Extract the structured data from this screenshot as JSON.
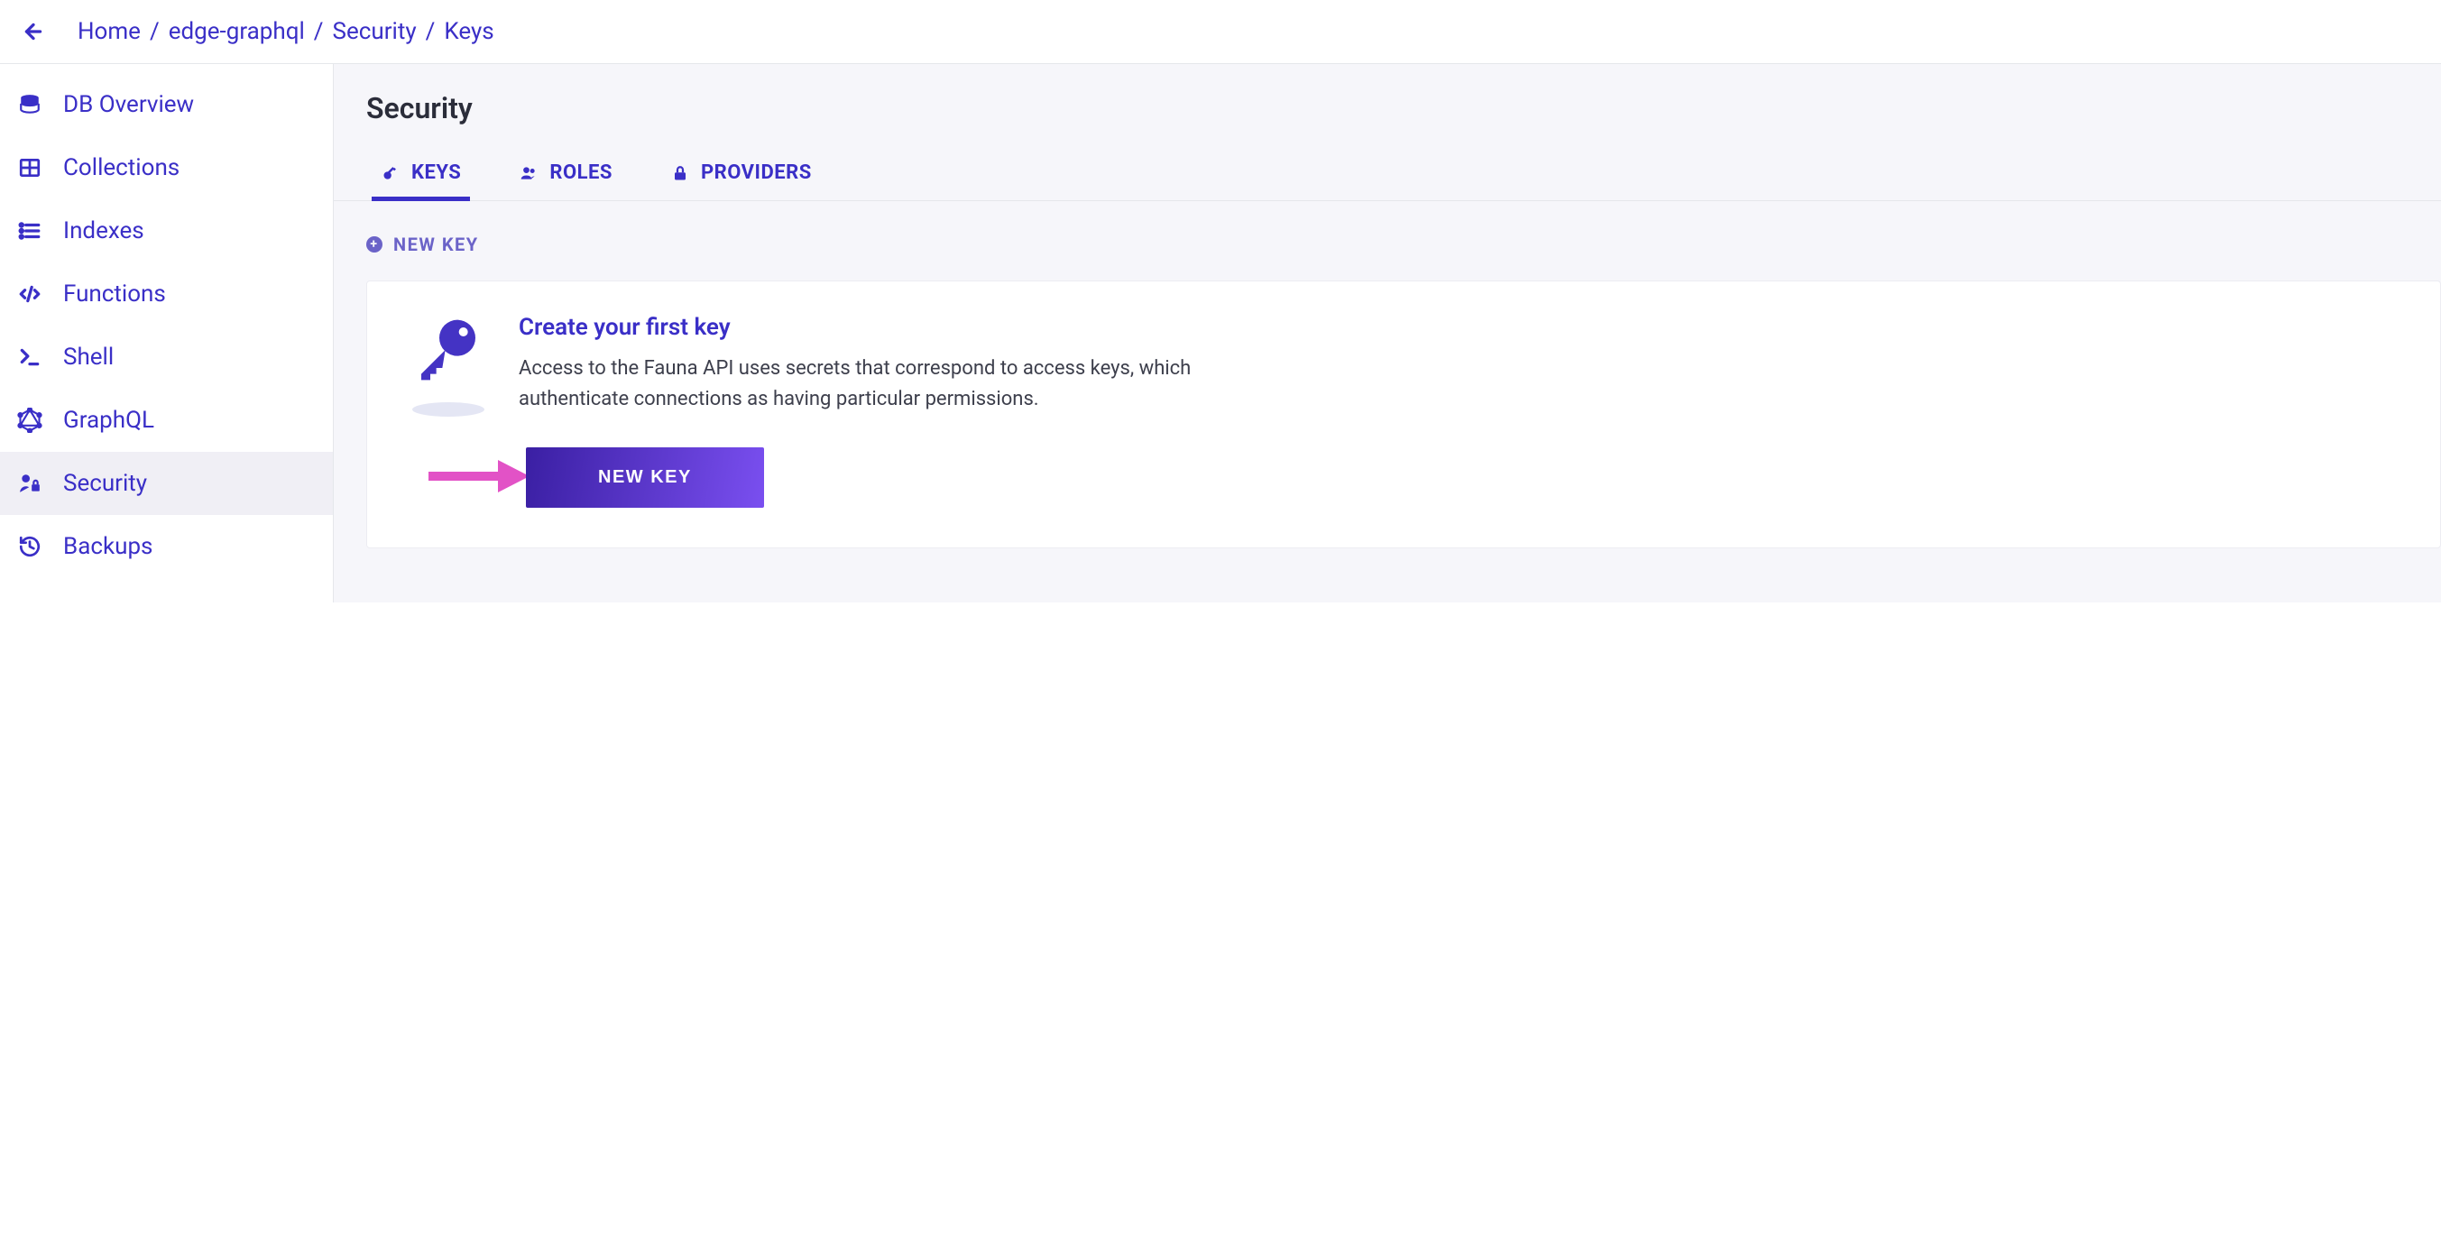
{
  "breadcrumbs": [
    "Home",
    "edge-graphql",
    "Security",
    "Keys"
  ],
  "sidebar": {
    "items": [
      {
        "label": "DB Overview",
        "icon": "database-icon"
      },
      {
        "label": "Collections",
        "icon": "table-icon"
      },
      {
        "label": "Indexes",
        "icon": "list-icon"
      },
      {
        "label": "Functions",
        "icon": "code-icon"
      },
      {
        "label": "Shell",
        "icon": "terminal-icon"
      },
      {
        "label": "GraphQL",
        "icon": "graphql-icon"
      },
      {
        "label": "Security",
        "icon": "user-lock-icon"
      },
      {
        "label": "Backups",
        "icon": "history-icon"
      }
    ],
    "active_index": 6
  },
  "page": {
    "title": "Security"
  },
  "tabs": {
    "items": [
      {
        "label": "KEYS",
        "icon": "key-icon"
      },
      {
        "label": "ROLES",
        "icon": "users-icon"
      },
      {
        "label": "PROVIDERS",
        "icon": "lock-icon"
      }
    ],
    "active_index": 0,
    "new_key_link": "NEW KEY"
  },
  "empty_state": {
    "heading": "Create your first key",
    "description": "Access to the Fauna API uses secrets that correspond to access keys, which authenticate connections as having particular permissions.",
    "button": "NEW KEY"
  },
  "colors": {
    "primary": "#3a2fc7",
    "annotation": "#e252c6"
  }
}
